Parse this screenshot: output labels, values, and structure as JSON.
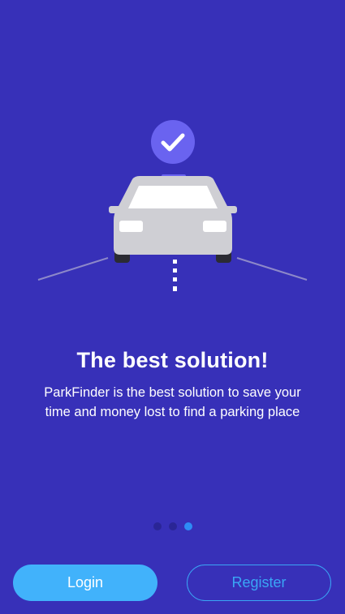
{
  "onboarding": {
    "title": "The best solution!",
    "description": "ParkFinder is the best solution to save your time and money lost to find a parking place",
    "illustration": {
      "badge_icon": "check-icon",
      "subject": "car-icon"
    },
    "pager": {
      "total": 3,
      "active_index": 2
    }
  },
  "actions": {
    "login_label": "Login",
    "register_label": "Register"
  },
  "colors": {
    "background": "#3730b8",
    "primary_button": "#41b2fb",
    "outline_button": "#3aa6f5",
    "dot_inactive": "#2a2596",
    "dot_active": "#2e8cf5",
    "badge": "#6a63f0"
  }
}
